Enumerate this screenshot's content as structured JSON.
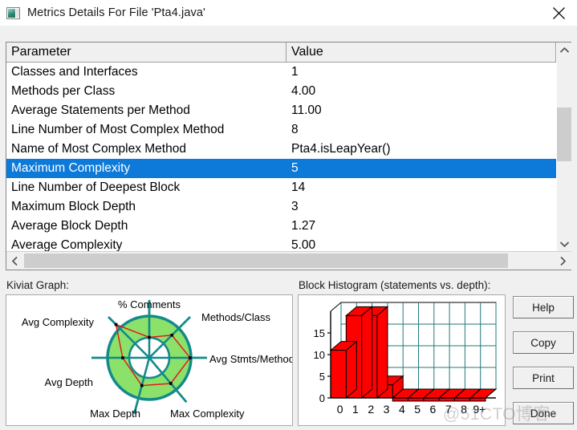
{
  "window": {
    "title": "Metrics Details For File 'Pta4.java'",
    "icon": "metrics-app-icon",
    "close_icon": "close-icon"
  },
  "table": {
    "columns": [
      "Parameter",
      "Value"
    ],
    "rows": [
      {
        "parameter": "Classes and Interfaces",
        "value": "1",
        "selected": false
      },
      {
        "parameter": "Methods per Class",
        "value": "4.00",
        "selected": false
      },
      {
        "parameter": "Average Statements per Method",
        "value": "11.00",
        "selected": false
      },
      {
        "parameter": "Line Number of Most Complex Method",
        "value": "8",
        "selected": false
      },
      {
        "parameter": "Name of Most Complex Method",
        "value": "Pta4.isLeapYear()",
        "selected": false
      },
      {
        "parameter": "Maximum Complexity",
        "value": "5",
        "selected": true
      },
      {
        "parameter": "Line Number of Deepest Block",
        "value": "14",
        "selected": false
      },
      {
        "parameter": "Maximum Block Depth",
        "value": "3",
        "selected": false
      },
      {
        "parameter": "Average Block Depth",
        "value": "1.27",
        "selected": false
      },
      {
        "parameter": "Average Complexity",
        "value": "5.00",
        "selected": false
      }
    ],
    "selection_color": "#0d7ad9",
    "scrollbar": {
      "up_icon": "chevron-up-icon",
      "down_icon": "chevron-down-icon",
      "left_icon": "chevron-left-icon",
      "right_icon": "chevron-right-icon"
    }
  },
  "kiviat": {
    "label": "Kiviat Graph:",
    "axes": [
      "% Comments",
      "Methods/Class",
      "Avg Stmts/Method",
      "Max Complexity",
      "Max Depth",
      "Avg Depth",
      "Avg Complexity"
    ],
    "band_color": "#8ce16b",
    "spoke_color": "#138a8a",
    "data_color": "#e01b1b"
  },
  "histogram": {
    "label": "Block Histogram (statements vs. depth):"
  },
  "chart_data": {
    "type": "bar",
    "title": "Block Histogram (statements vs. depth):",
    "xlabel": "",
    "ylabel": "",
    "categories": [
      "0",
      "1",
      "2",
      "3",
      "4",
      "5",
      "6",
      "7",
      "8",
      "9+"
    ],
    "values": [
      11,
      19,
      19,
      3,
      0,
      0,
      0,
      0,
      0,
      0
    ],
    "yticks": [
      0,
      5,
      10,
      15
    ],
    "ylim": [
      0,
      20
    ],
    "grid": true,
    "bar_color": "#ff0000",
    "grid_color": "#1f7a7a",
    "legend": "none"
  },
  "buttons": {
    "help": "Help",
    "copy": "Copy",
    "print": "Print",
    "done": "Done"
  },
  "watermark": {
    "text": "@51CTO博客"
  }
}
